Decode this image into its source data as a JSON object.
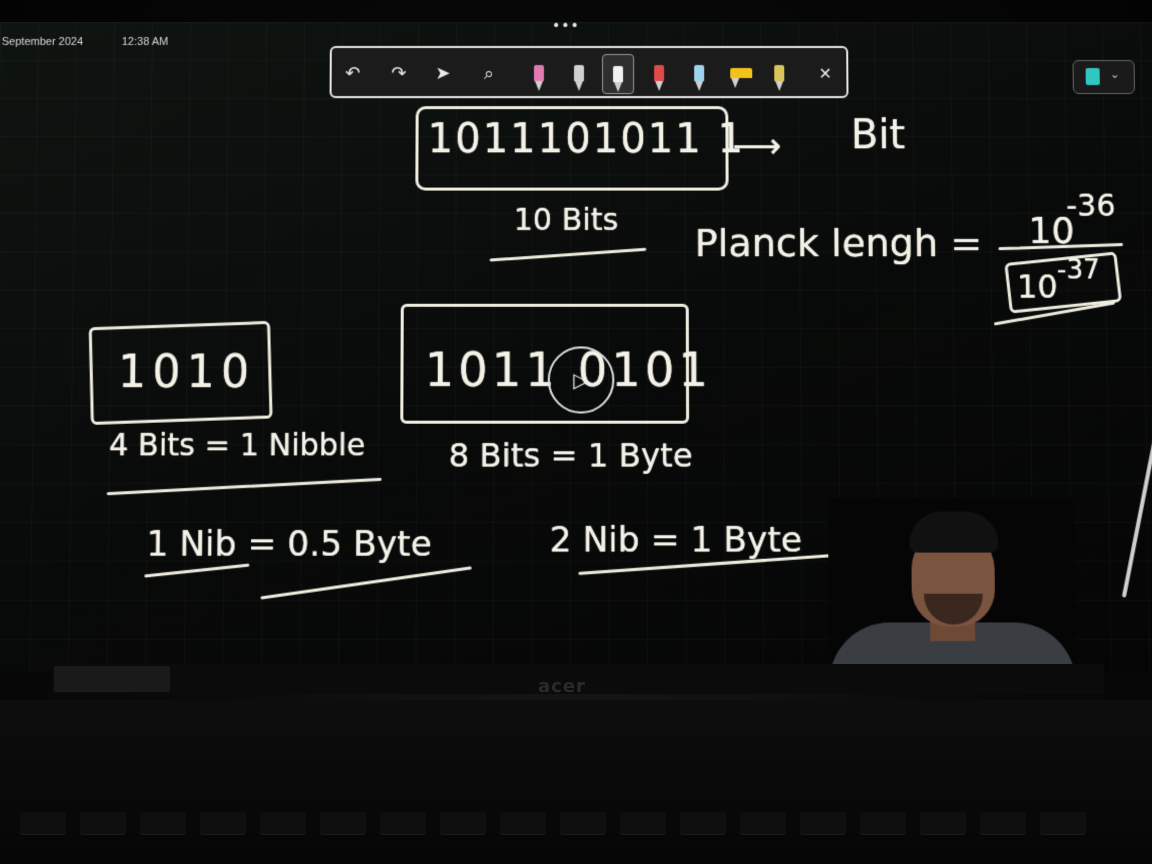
{
  "system": {
    "date": "September 2024",
    "time": "12:38 AM",
    "more_menu": "•••"
  },
  "toolbar": {
    "tools": [
      {
        "icon": "undo-icon",
        "glyph": "↶"
      },
      {
        "icon": "redo-icon",
        "glyph": "↷"
      },
      {
        "icon": "select-cursor-icon",
        "glyph": "➤"
      },
      {
        "icon": "magnifier-icon",
        "glyph": "⌕"
      },
      {
        "icon": "pink-eraser-pen-icon",
        "color": "#e07ab0"
      },
      {
        "icon": "white-pen-icon",
        "color": "#d0d0d0"
      },
      {
        "icon": "white-pen-selected-icon",
        "color": "#f2f2f2"
      },
      {
        "icon": "red-pen-icon",
        "color": "#e04a4a"
      },
      {
        "icon": "blue-pen-icon",
        "color": "#9ed3f0"
      },
      {
        "icon": "yellow-highlighter-icon",
        "color": "#f2c21a"
      },
      {
        "icon": "yellow-marker-icon",
        "color": "#d9c45a"
      }
    ],
    "close_glyph": "✕"
  },
  "whiteboard": {
    "binary_top": "1011101011 1",
    "bit_label": "Bit",
    "ten_bits": "10 Bits",
    "planck": "Planck lengh =",
    "planck_numerator": "10",
    "planck_num_exp": "-36",
    "planck_denominator": "10",
    "planck_den_exp": "-37",
    "nibble_box": "1010",
    "nibble_eq": "4 Bits = 1 Nibble",
    "byte_box": "1011 0101",
    "byte_eq": "8 Bits = 1 Byte",
    "nib_half": "1 Nib = 0.5 Byte",
    "nib_two": "2 Nib = 1 Byte"
  },
  "colors": {
    "ink": "#efece0",
    "board": "#0a0d0b",
    "app_icon": "#2fc7c0"
  },
  "device": {
    "logo_text": "acer"
  }
}
